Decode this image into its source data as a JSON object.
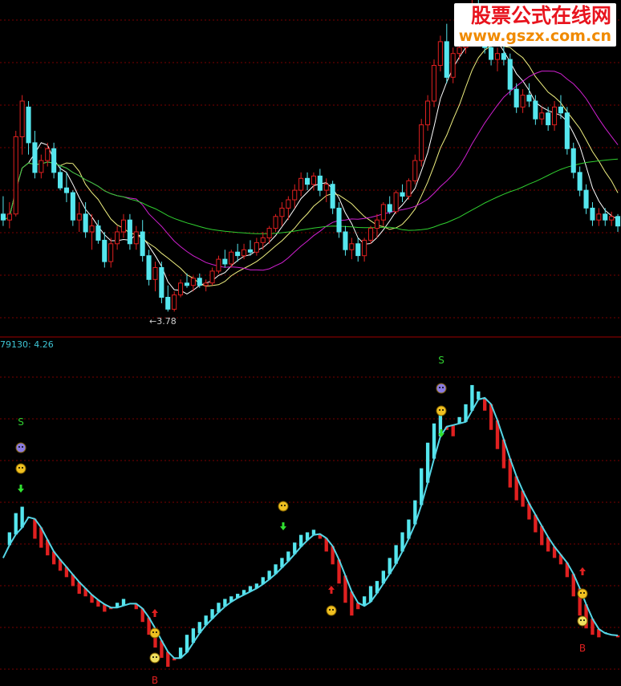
{
  "watermark": {
    "name": "股票公式在线网",
    "url": "www.gszx.com.cn"
  },
  "indicator_label": "79130: 4.26",
  "low_marker": "←3.78",
  "colors": {
    "up": "#e02020",
    "down": "#55e6ee",
    "ma5": "#ffffff",
    "ma10": "#f0f080",
    "ma20": "#d020d0",
    "ma60": "#30d030",
    "grid": "#7a0000",
    "osc_line": "#55d6e6"
  },
  "chart_data": [
    {
      "type": "candlestick",
      "title": "",
      "xlabel": "",
      "ylabel": "",
      "ylim": [
        3.6,
        6.4
      ],
      "series": [
        {
          "name": "price",
          "ohlc": [
            [
              4.6,
              4.75,
              4.5,
              4.55
            ],
            [
              4.55,
              4.7,
              4.48,
              4.6
            ],
            [
              4.6,
              5.3,
              4.58,
              5.25
            ],
            [
              5.25,
              5.6,
              5.1,
              5.55
            ],
            [
              5.5,
              5.55,
              5.1,
              5.2
            ],
            [
              5.2,
              5.3,
              4.9,
              4.95
            ],
            [
              4.95,
              5.1,
              4.9,
              5.05
            ],
            [
              5.05,
              5.2,
              5.0,
              5.15
            ],
            [
              5.15,
              5.2,
              4.9,
              4.95
            ],
            [
              4.95,
              5.0,
              4.8,
              4.82
            ],
            [
              4.82,
              4.95,
              4.7,
              4.78
            ],
            [
              4.78,
              4.8,
              4.5,
              4.55
            ],
            [
              4.55,
              4.7,
              4.45,
              4.6
            ],
            [
              4.6,
              4.7,
              4.4,
              4.45
            ],
            [
              4.45,
              4.6,
              4.3,
              4.5
            ],
            [
              4.5,
              4.55,
              4.35,
              4.38
            ],
            [
              4.38,
              4.45,
              4.15,
              4.2
            ],
            [
              4.2,
              4.4,
              4.15,
              4.35
            ],
            [
              4.35,
              4.5,
              4.3,
              4.45
            ],
            [
              4.45,
              4.6,
              4.4,
              4.55
            ],
            [
              4.55,
              4.6,
              4.3,
              4.35
            ],
            [
              4.35,
              4.5,
              4.3,
              4.45
            ],
            [
              4.45,
              4.55,
              4.2,
              4.25
            ],
            [
              4.25,
              4.3,
              4.0,
              4.05
            ],
            [
              4.05,
              4.2,
              3.95,
              4.15
            ],
            [
              4.15,
              4.2,
              3.85,
              3.9
            ],
            [
              3.9,
              4.0,
              3.78,
              3.8
            ],
            [
              3.8,
              3.95,
              3.78,
              3.92
            ],
            [
              3.92,
              4.05,
              3.9,
              4.02
            ],
            [
              4.02,
              4.1,
              3.98,
              4.0
            ],
            [
              4.0,
              4.08,
              3.95,
              4.06
            ],
            [
              4.06,
              4.1,
              3.98,
              4.0
            ],
            [
              4.0,
              4.05,
              3.95,
              4.02
            ],
            [
              4.02,
              4.15,
              4.0,
              4.12
            ],
            [
              4.12,
              4.25,
              4.1,
              4.22
            ],
            [
              4.22,
              4.3,
              4.15,
              4.18
            ],
            [
              4.18,
              4.3,
              4.15,
              4.28
            ],
            [
              4.28,
              4.35,
              4.2,
              4.25
            ],
            [
              4.25,
              4.35,
              4.22,
              4.3
            ],
            [
              4.3,
              4.38,
              4.25,
              4.28
            ],
            [
              4.28,
              4.4,
              4.25,
              4.36
            ],
            [
              4.36,
              4.45,
              4.3,
              4.4
            ],
            [
              4.4,
              4.5,
              4.35,
              4.48
            ],
            [
              4.48,
              4.6,
              4.45,
              4.58
            ],
            [
              4.58,
              4.7,
              4.5,
              4.65
            ],
            [
              4.65,
              4.75,
              4.55,
              4.72
            ],
            [
              4.72,
              4.85,
              4.65,
              4.8
            ],
            [
              4.8,
              4.95,
              4.75,
              4.9
            ],
            [
              4.9,
              4.95,
              4.8,
              4.85
            ],
            [
              4.85,
              4.95,
              4.8,
              4.92
            ],
            [
              4.92,
              4.98,
              4.75,
              4.8
            ],
            [
              4.8,
              4.9,
              4.7,
              4.85
            ],
            [
              4.85,
              4.88,
              4.6,
              4.65
            ],
            [
              4.65,
              4.7,
              4.4,
              4.45
            ],
            [
              4.45,
              4.5,
              4.25,
              4.3
            ],
            [
              4.3,
              4.4,
              4.22,
              4.35
            ],
            [
              4.35,
              4.4,
              4.2,
              4.25
            ],
            [
              4.25,
              4.4,
              4.2,
              4.38
            ],
            [
              4.38,
              4.5,
              4.35,
              4.48
            ],
            [
              4.48,
              4.6,
              4.4,
              4.55
            ],
            [
              4.55,
              4.7,
              4.5,
              4.68
            ],
            [
              4.68,
              4.75,
              4.6,
              4.62
            ],
            [
              4.62,
              4.8,
              4.6,
              4.78
            ],
            [
              4.78,
              4.85,
              4.7,
              4.75
            ],
            [
              4.75,
              4.9,
              4.72,
              4.88
            ],
            [
              4.88,
              5.1,
              4.85,
              5.05
            ],
            [
              5.05,
              5.4,
              5.0,
              5.35
            ],
            [
              5.35,
              5.6,
              5.3,
              5.55
            ],
            [
              5.55,
              5.9,
              5.5,
              5.85
            ],
            [
              5.85,
              6.1,
              5.8,
              6.05
            ],
            [
              6.05,
              6.2,
              5.7,
              5.75
            ],
            [
              5.75,
              6.0,
              5.7,
              5.95
            ],
            [
              5.95,
              6.1,
              5.9,
              6.0
            ],
            [
              6.0,
              6.3,
              5.95,
              6.25
            ],
            [
              6.25,
              6.4,
              6.1,
              6.3
            ],
            [
              6.3,
              6.4,
              6.05,
              6.1
            ],
            [
              6.1,
              6.2,
              5.95,
              6.0
            ],
            [
              6.0,
              6.1,
              5.85,
              5.9
            ],
            [
              5.9,
              6.0,
              5.8,
              5.95
            ],
            [
              5.95,
              6.05,
              5.85,
              5.9
            ],
            [
              5.9,
              5.95,
              5.6,
              5.65
            ],
            [
              5.65,
              5.7,
              5.45,
              5.5
            ],
            [
              5.5,
              5.65,
              5.45,
              5.6
            ],
            [
              5.6,
              5.7,
              5.5,
              5.55
            ],
            [
              5.55,
              5.6,
              5.35,
              5.4
            ],
            [
              5.4,
              5.5,
              5.35,
              5.45
            ],
            [
              5.45,
              5.5,
              5.3,
              5.35
            ],
            [
              5.35,
              5.55,
              5.3,
              5.5
            ],
            [
              5.5,
              5.6,
              5.4,
              5.45
            ],
            [
              5.45,
              5.5,
              5.1,
              5.15
            ],
            [
              5.15,
              5.2,
              4.9,
              4.95
            ],
            [
              4.95,
              5.0,
              4.75,
              4.8
            ],
            [
              4.8,
              4.85,
              4.6,
              4.65
            ],
            [
              4.65,
              4.7,
              4.5,
              4.55
            ],
            [
              4.55,
              4.65,
              4.5,
              4.6
            ],
            [
              4.6,
              4.65,
              4.5,
              4.55
            ],
            [
              4.55,
              4.62,
              4.5,
              4.58
            ],
            [
              4.58,
              4.6,
              4.45,
              4.5
            ]
          ]
        },
        {
          "name": "MA5"
        },
        {
          "name": "MA10"
        },
        {
          "name": "MA20"
        },
        {
          "name": "MA60"
        }
      ]
    },
    {
      "type": "bar",
      "title": "",
      "ylim": [
        -1.0,
        1.6
      ],
      "series": [
        {
          "name": "79130",
          "values": [
            0.0,
            0.2,
            0.35,
            0.4,
            0.32,
            0.15,
            0.08,
            0.02,
            -0.05,
            -0.1,
            -0.15,
            -0.22,
            -0.28,
            -0.3,
            -0.35,
            -0.38,
            -0.42,
            -0.4,
            -0.35,
            -0.32,
            -0.36,
            -0.4,
            -0.5,
            -0.6,
            -0.7,
            -0.78,
            -0.85,
            -0.8,
            -0.7,
            -0.6,
            -0.55,
            -0.5,
            -0.45,
            -0.4,
            -0.35,
            -0.32,
            -0.3,
            -0.28,
            -0.25,
            -0.22,
            -0.2,
            -0.15,
            -0.1,
            -0.05,
            0.0,
            0.05,
            0.12,
            0.18,
            0.2,
            0.22,
            0.15,
            0.05,
            -0.05,
            -0.2,
            -0.35,
            -0.45,
            -0.4,
            -0.3,
            -0.22,
            -0.18,
            -0.1,
            0.0,
            0.1,
            0.2,
            0.3,
            0.45,
            0.7,
            0.9,
            1.05,
            1.15,
            1.0,
            0.95,
            1.1,
            1.2,
            1.35,
            1.3,
            1.15,
            1.0,
            0.85,
            0.7,
            0.55,
            0.45,
            0.4,
            0.3,
            0.2,
            0.1,
            0.05,
            0.0,
            -0.05,
            -0.15,
            -0.3,
            -0.45,
            -0.55,
            -0.6,
            -0.62,
            -0.58,
            -0.6,
            -0.62
          ]
        }
      ]
    }
  ]
}
